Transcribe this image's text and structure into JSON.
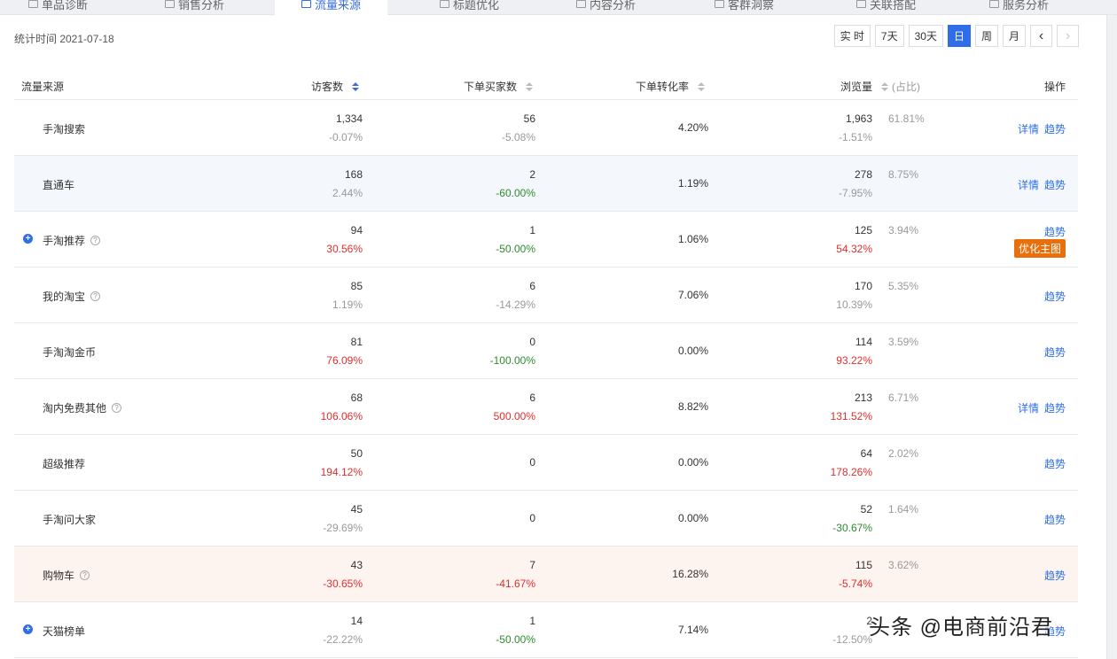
{
  "tabs": [
    {
      "label": "单品诊断"
    },
    {
      "label": "销售分析"
    },
    {
      "label": "流量来源"
    },
    {
      "label": "标题优化"
    },
    {
      "label": "内容分析"
    },
    {
      "label": "客群洞察"
    },
    {
      "label": "关联搭配"
    },
    {
      "label": "服务分析"
    }
  ],
  "active_tab": "流量来源",
  "stat_time": "统计时间 2021-07-18",
  "periods": {
    "realtime": "实 时",
    "d7": "7天",
    "d30": "30天",
    "day": "日",
    "week": "周",
    "month": "月",
    "prev": "‹",
    "next": "›"
  },
  "table": {
    "headers": {
      "source": "流量来源",
      "visitors": "访客数",
      "buyers": "下单买家数",
      "conversion": "下单转化率",
      "views": "浏览量",
      "share": "(占比)",
      "ops": "操作"
    },
    "ops_labels": {
      "detail": "详情",
      "trend": "趋势",
      "optimize": "优化主图"
    },
    "rows": [
      {
        "name": "手淘搜索",
        "visitors": "1,334",
        "visitors_change": "-0.07%",
        "buyers": "56",
        "buyers_change": "-5.08%",
        "conversion": "4.20%",
        "views": "1,963",
        "views_change": "-1.51%",
        "share": "61.81%"
      },
      {
        "name": "直通车",
        "visitors": "168",
        "visitors_change": "2.44%",
        "buyers": "2",
        "buyers_change": "-60.00%",
        "conversion": "1.19%",
        "views": "278",
        "views_change": "-7.95%",
        "share": "8.75%"
      },
      {
        "name": "手淘推荐",
        "visitors": "94",
        "visitors_change": "30.56%",
        "buyers": "1",
        "buyers_change": "-50.00%",
        "conversion": "1.06%",
        "views": "125",
        "views_change": "54.32%",
        "share": "3.94%"
      },
      {
        "name": "我的淘宝",
        "visitors": "85",
        "visitors_change": "1.19%",
        "buyers": "6",
        "buyers_change": "-14.29%",
        "conversion": "7.06%",
        "views": "170",
        "views_change": "10.39%",
        "share": "5.35%"
      },
      {
        "name": "手淘淘金币",
        "visitors": "81",
        "visitors_change": "76.09%",
        "buyers": "0",
        "buyers_change": "-100.00%",
        "conversion": "0.00%",
        "views": "114",
        "views_change": "93.22%",
        "share": "3.59%"
      },
      {
        "name": "淘内免费其他",
        "visitors": "68",
        "visitors_change": "106.06%",
        "buyers": "6",
        "buyers_change": "500.00%",
        "conversion": "8.82%",
        "views": "213",
        "views_change": "131.52%",
        "share": "6.71%"
      },
      {
        "name": "超级推荐",
        "visitors": "50",
        "visitors_change": "194.12%",
        "buyers": "0",
        "conversion": "0.00%",
        "views": "64",
        "views_change": "178.26%",
        "share": "2.02%"
      },
      {
        "name": "手淘问大家",
        "visitors": "45",
        "visitors_change": "-29.69%",
        "buyers": "0",
        "conversion": "0.00%",
        "views": "52",
        "views_change": "-30.67%",
        "share": "1.64%"
      },
      {
        "name": "购物车",
        "visitors": "43",
        "visitors_change": "-30.65%",
        "buyers": "7",
        "buyers_change": "-41.67%",
        "conversion": "16.28%",
        "views": "115",
        "views_change": "-5.74%",
        "share": "3.62%"
      },
      {
        "name": "天猫榜单",
        "visitors": "14",
        "visitors_change": "-22.22%",
        "buyers": "1",
        "buyers_change": "-50.00%",
        "conversion": "7.14%",
        "views": "2",
        "views_change": "-12.50%",
        "share": ""
      }
    ]
  },
  "watermark": "头条 @电商前沿君",
  "colors": {
    "accent": "#2f6ee8",
    "up": "#e02e2e",
    "down": "#2e8a2e",
    "neutral": "#999999",
    "badge": "#e8700c"
  }
}
